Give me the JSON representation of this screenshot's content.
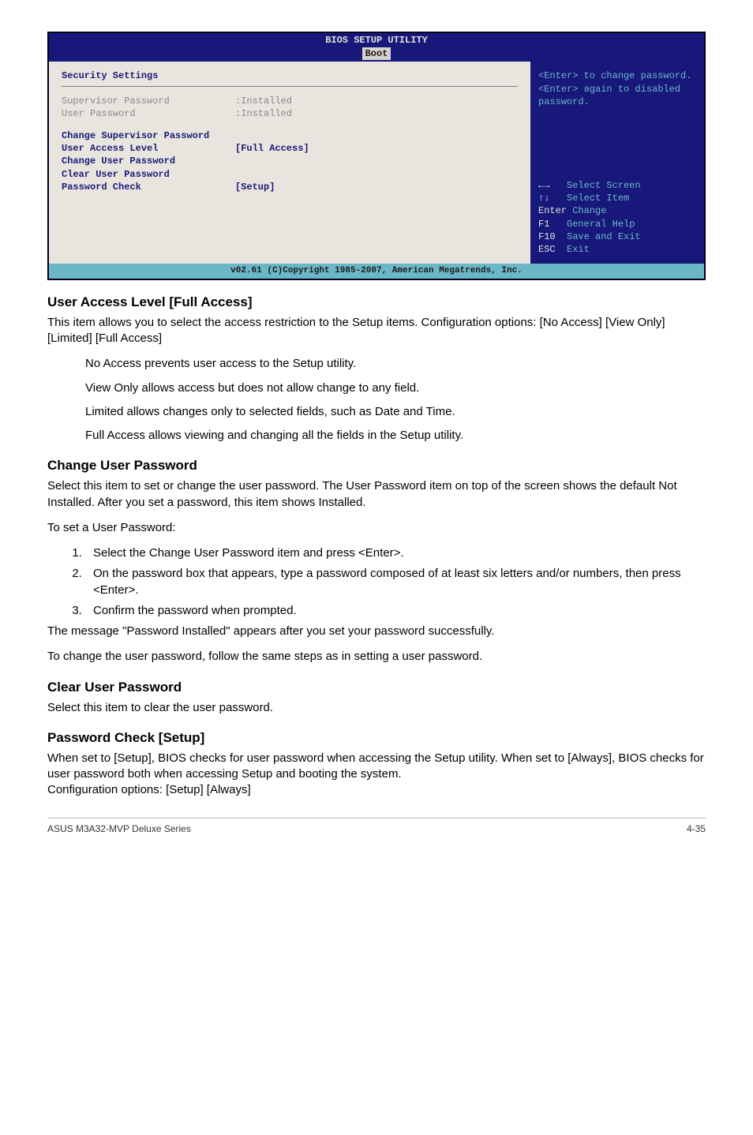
{
  "bios": {
    "headerTitle": "BIOS SETUP UTILITY",
    "tab": "Boot",
    "left": {
      "title": "Security Settings",
      "supLabel": "Supervisor Password",
      "supVal": ":Installed",
      "userLabel": "User Password",
      "userVal": ":Installed",
      "changeSup": "Change Supervisor Password",
      "ualLabel": "User Access Level",
      "ualVal": "[Full Access]",
      "changeUser": "Change User Password",
      "clearUser": "Clear User Password",
      "pwCheckLabel": "Password Check",
      "pwCheckVal": "[Setup]"
    },
    "right": {
      "help1": "<Enter> to change password.",
      "help2": "<Enter> again to disabled password.",
      "leg1a": "Select Screen",
      "leg2a": "Select Item",
      "leg3a": "Enter",
      "leg3b": "Change",
      "leg4a": "F1",
      "leg4b": "General Help",
      "leg5a": "F10",
      "leg5b": "Save and Exit",
      "leg6a": "ESC",
      "leg6b": "Exit"
    },
    "footer": "v02.61 (C)Copyright 1985-2007, American Megatrends, Inc."
  },
  "s1": {
    "h": "User Access Level [Full Access]",
    "p1": "This item allows you to select the access restriction to the Setup items. Configuration options: [No Access] [View Only] [Limited] [Full Access]",
    "b1": "No Access prevents user access to the Setup utility.",
    "b2": "View Only allows access but does not allow change to any field.",
    "b3": "Limited allows changes only to selected fields, such as Date and Time.",
    "b4": "Full Access allows viewing and changing all the fields in the Setup utility."
  },
  "s2": {
    "h": "Change User Password",
    "p1": "Select this item to set or change the user password. The User Password item on top of the screen shows the default Not Installed. After you set a password, this item shows Installed.",
    "p2": "To set a User Password:",
    "li1": "Select the Change User Password item and press <Enter>.",
    "li2": "On the password box that appears, type a password composed of at least six letters and/or numbers, then press <Enter>.",
    "li3": "Confirm the password when prompted.",
    "p3": "The message \"Password Installed\" appears after you set your password successfully.",
    "p4": "To change the user password, follow the same steps as in setting a user password."
  },
  "s3": {
    "h": "Clear User Password",
    "p1": "Select this item to clear the user password."
  },
  "s4": {
    "h": "Password Check [Setup]",
    "p1": "When set to [Setup], BIOS checks for user password when accessing the Setup utility. When set to [Always], BIOS checks for user password both when accessing Setup and booting the system.",
    "p2": "Configuration options: [Setup] [Always]"
  },
  "footer": {
    "left": "ASUS M3A32-MVP Deluxe Series",
    "right": "4-35"
  }
}
